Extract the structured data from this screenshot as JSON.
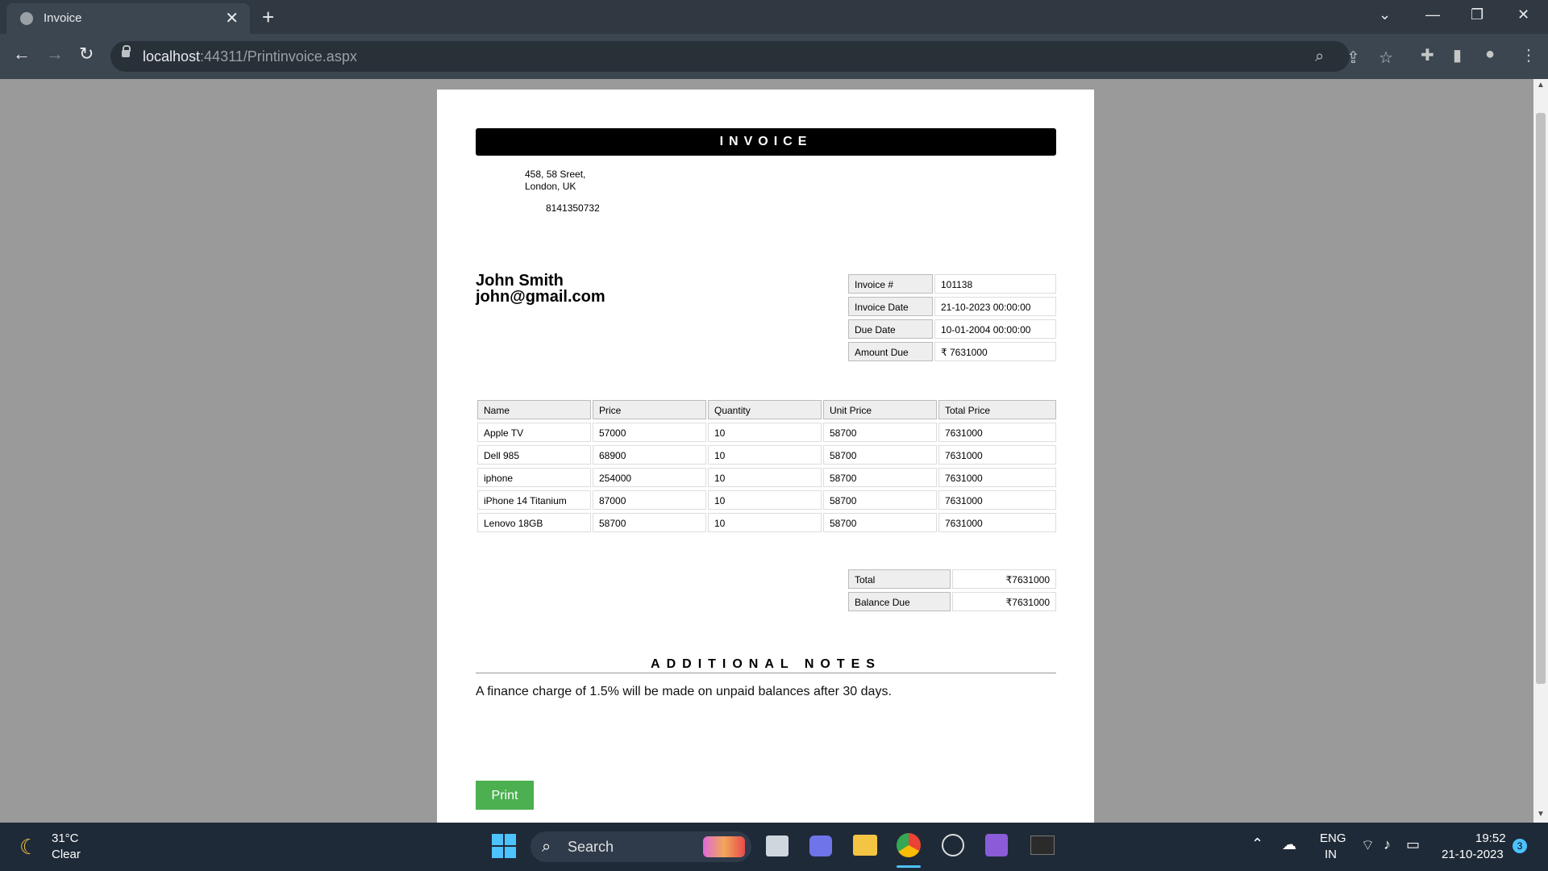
{
  "browser": {
    "tab_title": "Invoice",
    "tab_close": "✕",
    "new_tab": "+",
    "url_host": "localhost",
    "url_rest": ":44311/Printinvoice.aspx"
  },
  "invoice": {
    "header": "INVOICE",
    "address_line1": "458, 58 Sreet,",
    "address_line2": "London, UK",
    "phone": "8141350732",
    "customer_name": "John Smith",
    "customer_email": "john@gmail.com",
    "meta": [
      {
        "label": "Invoice #",
        "value": "101138"
      },
      {
        "label": "Invoice Date",
        "value": "21-10-2023 00:00:00"
      },
      {
        "label": "Due Date",
        "value": "10-01-2004 00:00:00"
      },
      {
        "label": "Amount Due",
        "value": "₹ 7631000"
      }
    ],
    "columns": [
      "Name",
      "Price",
      "Quantity",
      "Unit Price",
      "Total Price"
    ],
    "rows": [
      [
        "Apple TV",
        "57000",
        "10",
        "58700",
        "7631000"
      ],
      [
        "Dell 985",
        "68900",
        "10",
        "58700",
        "7631000"
      ],
      [
        "iphone",
        "254000",
        "10",
        "58700",
        "7631000"
      ],
      [
        "iPhone 14 Titanium",
        "87000",
        "10",
        "58700",
        "7631000"
      ],
      [
        "Lenovo 18GB",
        "58700",
        "10",
        "58700",
        "7631000"
      ]
    ],
    "totals": [
      {
        "label": "Total",
        "value": "₹7631000"
      },
      {
        "label": "Balance Due",
        "value": "₹7631000"
      }
    ],
    "notes_title": "ADDITIONAL NOTES",
    "notes_text": "A finance charge of 1.5% will be made on unpaid balances after 30 days.",
    "print_label": "Print"
  },
  "taskbar": {
    "weather_temp": "31°C",
    "weather_desc": "Clear",
    "search_label": "Search",
    "lang1": "ENG",
    "lang2": "IN",
    "time": "19:52",
    "date": "21-10-2023",
    "notification_count": "3"
  },
  "colors": {
    "print_button": "#4caf50",
    "header_bg": "#000000"
  }
}
